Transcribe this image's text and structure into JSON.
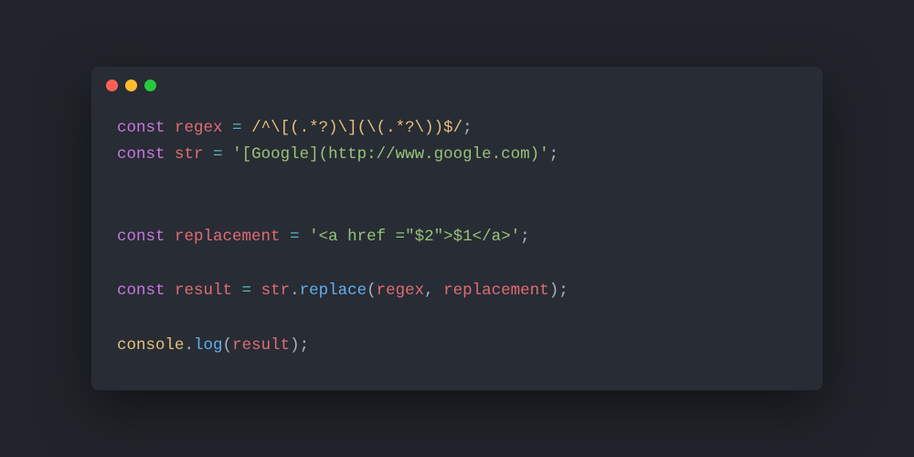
{
  "window": {
    "controls": [
      "close",
      "minimize",
      "zoom"
    ],
    "colors": {
      "close": "#ff5f56",
      "minimize": "#ffbd2e",
      "zoom": "#27c93f"
    }
  },
  "code": {
    "lines": [
      {
        "tokens": [
          {
            "t": "const ",
            "c": "kw"
          },
          {
            "t": "regex",
            "c": "var"
          },
          {
            "t": " ",
            "c": "op"
          },
          {
            "t": "=",
            "c": "op2"
          },
          {
            "t": " ",
            "c": "op"
          },
          {
            "t": "/^\\[(.*?)\\](\\(.*?\\))$/",
            "c": "rgx"
          },
          {
            "t": ";",
            "c": "op"
          }
        ]
      },
      {
        "tokens": [
          {
            "t": "const ",
            "c": "kw"
          },
          {
            "t": "str",
            "c": "var"
          },
          {
            "t": " ",
            "c": "op"
          },
          {
            "t": "=",
            "c": "op2"
          },
          {
            "t": " ",
            "c": "op"
          },
          {
            "t": "'[Google](http://www.google.com)'",
            "c": "str"
          },
          {
            "t": ";",
            "c": "op"
          }
        ]
      },
      {
        "blank": true
      },
      {
        "blank": true
      },
      {
        "tokens": [
          {
            "t": "const ",
            "c": "kw"
          },
          {
            "t": "replacement",
            "c": "var"
          },
          {
            "t": " ",
            "c": "op"
          },
          {
            "t": "=",
            "c": "op2"
          },
          {
            "t": " ",
            "c": "op"
          },
          {
            "t": "'<a href =\"$2\">$1</a>'",
            "c": "str"
          },
          {
            "t": ";",
            "c": "op"
          }
        ]
      },
      {
        "blank": true
      },
      {
        "tokens": [
          {
            "t": "const ",
            "c": "kw"
          },
          {
            "t": "result",
            "c": "var"
          },
          {
            "t": " ",
            "c": "op"
          },
          {
            "t": "=",
            "c": "op2"
          },
          {
            "t": " ",
            "c": "op"
          },
          {
            "t": "str",
            "c": "var"
          },
          {
            "t": ".",
            "c": "op"
          },
          {
            "t": "replace",
            "c": "fn"
          },
          {
            "t": "(",
            "c": "op"
          },
          {
            "t": "regex",
            "c": "var"
          },
          {
            "t": ", ",
            "c": "op"
          },
          {
            "t": "replacement",
            "c": "var"
          },
          {
            "t": ");",
            "c": "op"
          }
        ]
      },
      {
        "blank": true
      },
      {
        "tokens": [
          {
            "t": "console",
            "c": "obj"
          },
          {
            "t": ".",
            "c": "op"
          },
          {
            "t": "log",
            "c": "fn"
          },
          {
            "t": "(",
            "c": "op"
          },
          {
            "t": "result",
            "c": "var"
          },
          {
            "t": ");",
            "c": "op"
          }
        ]
      }
    ]
  }
}
